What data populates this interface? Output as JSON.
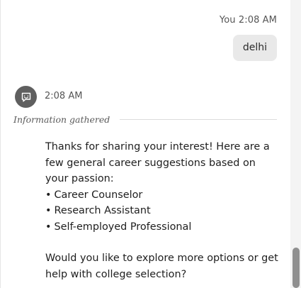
{
  "user_message": {
    "sender": "You",
    "time": "2:08 AM",
    "text": "delhi"
  },
  "bot_message": {
    "time": "2:08 AM",
    "status_label": "Information gathered",
    "avatar_icon": "chat-bot-icon",
    "intro": "Thanks for sharing your interest! Here are a few general career suggestions based on your passion:",
    "suggestions": [
      "Career Counselor",
      "Research Assistant",
      "Self-employed Professional"
    ],
    "closing": "Would you like to explore more options or get help with college selection?"
  },
  "colors": {
    "user_bubble_bg": "#e9e9e9",
    "avatar_bg": "#5f5f5f",
    "scroll_thumb": "#8f8f8f"
  }
}
